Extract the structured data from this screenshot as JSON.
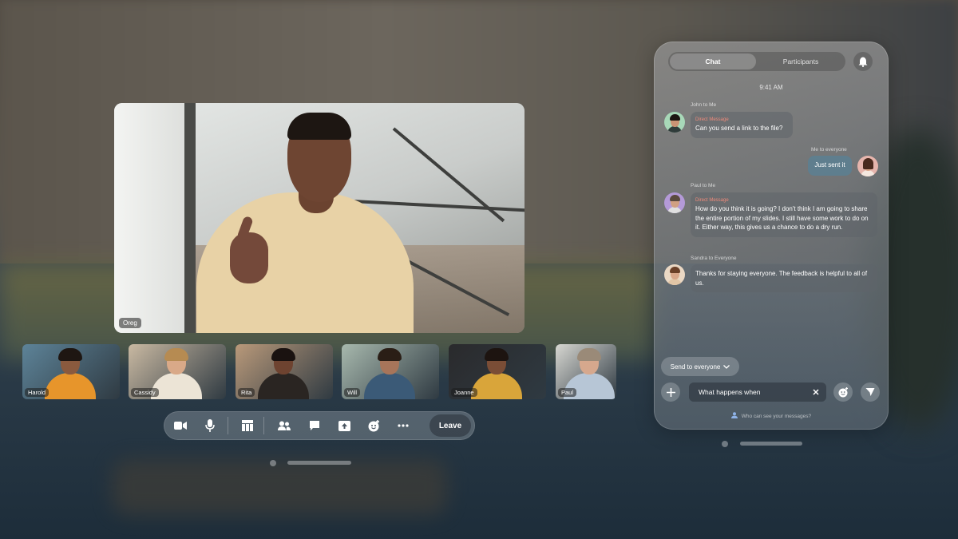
{
  "main_video": {
    "participant_name": "Oreg"
  },
  "thumbnails": [
    {
      "name": "Harold",
      "bg": "#5d8398",
      "skin": "#8a5a3e",
      "hair": "#1e1612",
      "shirt": "#e7952b"
    },
    {
      "name": "Cassidy",
      "bg": "#c9b9a2",
      "skin": "#d9a988",
      "hair": "#b68b52",
      "shirt": "#ece4d6"
    },
    {
      "name": "Rita",
      "bg": "#b9997a",
      "skin": "#6e4330",
      "hair": "#1a1210",
      "shirt": "#2a2522"
    },
    {
      "name": "Will",
      "bg": "#a7b8ad",
      "skin": "#a7755a",
      "hair": "#2a1e16",
      "shirt": "#3b5a77"
    },
    {
      "name": "Joanne",
      "bg": "#2a2a2c",
      "skin": "#7a4d36",
      "hair": "#1d1410",
      "shirt": "#d9a53a"
    },
    {
      "name": "Paul",
      "bg": "#d7d7d2",
      "skin": "#d6a88d",
      "hair": "#9a8a78",
      "shirt": "#b7c6d6"
    }
  ],
  "toolbar": {
    "icons": [
      "camera-icon",
      "microphone-icon",
      "layout-grid-icon",
      "participants-icon",
      "chat-icon",
      "share-screen-icon",
      "reactions-icon",
      "more-icon"
    ],
    "leave_label": "Leave"
  },
  "chat": {
    "tabs": {
      "chat": "Chat",
      "participants": "Participants"
    },
    "time": "9:41 AM",
    "messages": [
      {
        "meta": "John to Me",
        "direct": "Direct Message",
        "text": "Can you send a link to the file?"
      },
      {
        "meta": "Me to everyone",
        "text": "Just sent it"
      },
      {
        "meta": "Paul to Me",
        "direct": "Direct Message",
        "text": "How do you think it is going? I don't think I am going to share the entire portion of my slides. I still have some work to do on it. Either way, this gives us a chance to do a dry run."
      },
      {
        "meta": "Sandra to Everyone",
        "text": "Thanks for staying everyone. The feedback is helpful to all of us."
      }
    ],
    "send_to": "Send to everyone",
    "input_value": "What happens when",
    "who_can_see": "Who can see your messages?"
  }
}
